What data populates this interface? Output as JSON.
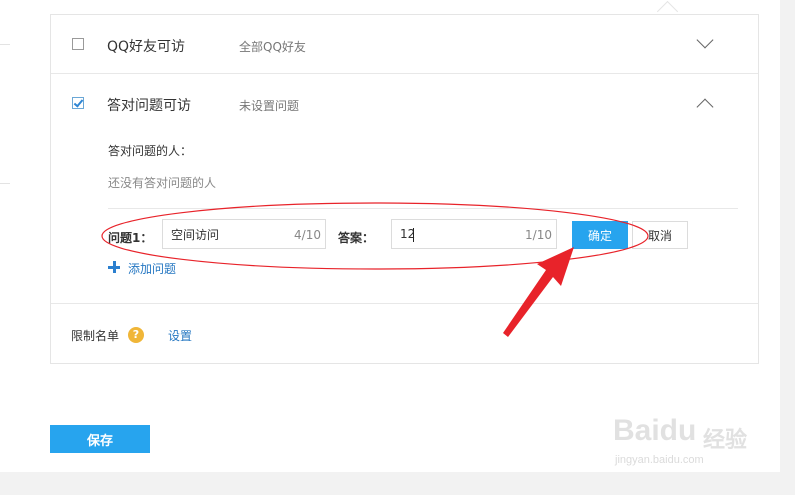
{
  "privacy_options": [
    {
      "title": "QQ好友可访",
      "subtitle": "全部QQ好友",
      "checked": false,
      "expanded": false
    },
    {
      "title": "答对问题可访",
      "subtitle": "未设置问题",
      "checked": true,
      "expanded": true
    }
  ],
  "question_section": {
    "answered_label": "答对问题的人：",
    "no_one_text": "还没有答对问题的人",
    "question_label": "问题1：",
    "question_value": "空间访问",
    "question_counter": "4/10",
    "answer_label": "答案：",
    "answer_value": "12",
    "answer_counter": "1/10",
    "confirm_label": "确定",
    "cancel_label": "取消",
    "add_question_label": "添加问题"
  },
  "blocklist": {
    "label": "限制名单",
    "help_glyph": "?",
    "settings_label": "设置"
  },
  "save_label": "保存",
  "watermark": {
    "brand": "Baidu",
    "brand_cn": "经验",
    "url": "jingyan.baidu.com"
  },
  "colors": {
    "accent": "#27a4ee",
    "link": "#2577c2",
    "annotation": "#e8232a",
    "help": "#f0b638"
  },
  "icons": [
    "checkbox-icon",
    "chevron-down-icon",
    "chevron-up-icon",
    "plus-icon",
    "help-icon"
  ]
}
